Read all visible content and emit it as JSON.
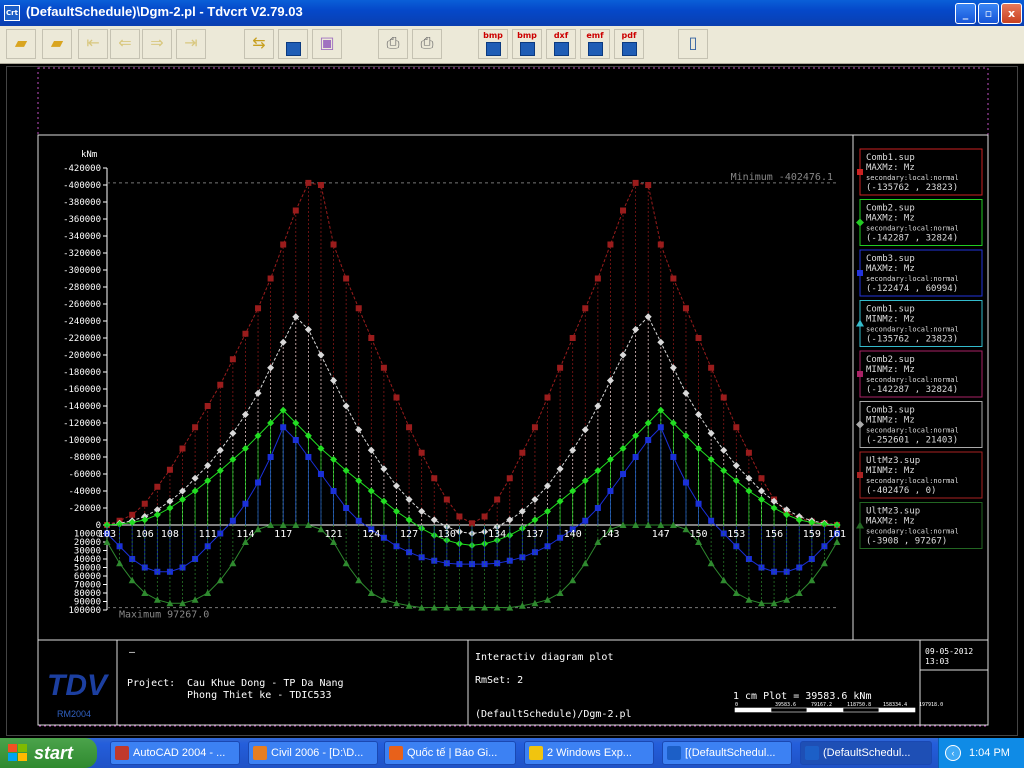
{
  "window": {
    "title": "(DefaultSchedule)\\Dgm-2.pl - Tdvcrt V2.79.03",
    "icon_text": "Crt",
    "buttons": [
      "_",
      "▫",
      "x"
    ]
  },
  "toolbar": {
    "export_labels": [
      "bmp",
      "bmp",
      "dxf",
      "emf",
      "pdf"
    ]
  },
  "chart_data": {
    "type": "line",
    "unit": "kNm",
    "x": [
      103,
      104,
      105,
      106,
      107,
      108,
      109,
      110,
      111,
      112,
      113,
      114,
      115,
      116,
      117,
      118,
      119,
      120,
      121,
      122,
      123,
      124,
      125,
      126,
      127,
      128,
      129,
      130,
      131,
      132,
      133,
      134,
      135,
      136,
      137,
      138,
      139,
      140,
      141,
      142,
      143,
      144,
      145,
      146,
      147,
      148,
      149,
      150,
      151,
      152,
      153,
      154,
      155,
      156,
      157,
      158,
      159,
      160,
      161
    ],
    "x_tick_labels": [
      {
        "label": "103",
        "x": 103
      },
      {
        "label": "106",
        "x": 106
      },
      {
        "label": "108",
        "x": 108
      },
      {
        "label": "111",
        "x": 111
      },
      {
        "label": "114",
        "x": 114
      },
      {
        "label": "117",
        "x": 117
      },
      {
        "label": "121",
        "x": 121
      },
      {
        "label": "124",
        "x": 124
      },
      {
        "label": "127",
        "x": 127
      },
      {
        "label": "130",
        "x": 130
      },
      {
        "label": "134",
        "x": 134
      },
      {
        "label": "137",
        "x": 137
      },
      {
        "label": "140",
        "x": 140
      },
      {
        "label": "143",
        "x": 143
      },
      {
        "label": "147",
        "x": 147
      },
      {
        "label": "150",
        "x": 150
      },
      {
        "label": "153",
        "x": 153
      },
      {
        "label": "156",
        "x": 156
      },
      {
        "label": "159",
        "x": 159
      },
      {
        "label": "161",
        "x": 161
      }
    ],
    "y_ticks_neg": [
      "-420000",
      "-400000",
      "-380000",
      "-360000",
      "-340000",
      "-320000",
      "-300000",
      "-280000",
      "-260000",
      "-240000",
      "-220000",
      "-200000",
      "-180000",
      "-160000",
      "-140000",
      "-120000",
      "-100000",
      "-80000",
      "-60000",
      "-40000",
      "-20000",
      "0"
    ],
    "y_ticks_pos": [
      "10000",
      "20000",
      "30000",
      "40000",
      "50000",
      "60000",
      "70000",
      "80000",
      "90000",
      "100000"
    ],
    "ylim": [
      -420000,
      100000
    ],
    "min_annotation": "Minimum  -402476.1",
    "max_annotation": "Maximum  97267.0",
    "series": [
      {
        "name": "UltMz3.sup MINMz",
        "color": "#9a1c1c",
        "marker": "square",
        "values": [
          0,
          -5000,
          -12000,
          -25000,
          -45000,
          -65000,
          -90000,
          -115000,
          -140000,
          -165000,
          -195000,
          -225000,
          -255000,
          -290000,
          -330000,
          -370000,
          -402476,
          -400000,
          -330000,
          -290000,
          -255000,
          -220000,
          -185000,
          -150000,
          -115000,
          -85000,
          -55000,
          -30000,
          -10000,
          -2000,
          -10000,
          -30000,
          -55000,
          -85000,
          -115000,
          -150000,
          -185000,
          -220000,
          -255000,
          -290000,
          -330000,
          -370000,
          -402476,
          -400000,
          -330000,
          -290000,
          -255000,
          -220000,
          -185000,
          -150000,
          -115000,
          -85000,
          -55000,
          -30000,
          -15000,
          -8000,
          -4000,
          -2000,
          0
        ]
      },
      {
        "name": "Comb3.sup MINMz",
        "color": "#d9d9d9",
        "marker": "diamond",
        "values": [
          0,
          -2000,
          -5000,
          -10000,
          -18000,
          -28000,
          -40000,
          -55000,
          -70000,
          -88000,
          -108000,
          -130000,
          -155000,
          -185000,
          -215000,
          -245000,
          -230000,
          -200000,
          -170000,
          -140000,
          -112000,
          -88000,
          -66000,
          -46000,
          -30000,
          -16000,
          -6000,
          2000,
          8000,
          10000,
          8000,
          2000,
          -6000,
          -16000,
          -30000,
          -46000,
          -66000,
          -88000,
          -112000,
          -140000,
          -170000,
          -200000,
          -230000,
          -245000,
          -215000,
          -185000,
          -155000,
          -130000,
          -108000,
          -88000,
          -70000,
          -55000,
          -40000,
          -28000,
          -18000,
          -10000,
          -5000,
          -2000,
          0
        ]
      },
      {
        "name": "Comb2.sup MAXMz",
        "color": "#22dd22",
        "marker": "diamond",
        "values": [
          0,
          -1000,
          -3000,
          -6000,
          -12000,
          -20000,
          -30000,
          -40000,
          -52000,
          -64000,
          -77000,
          -90000,
          -105000,
          -120000,
          -135000,
          -120000,
          -105000,
          -90000,
          -77000,
          -64000,
          -52000,
          -40000,
          -28000,
          -16000,
          -6000,
          4000,
          12000,
          18000,
          22000,
          24000,
          22000,
          18000,
          12000,
          4000,
          -6000,
          -16000,
          -28000,
          -40000,
          -52000,
          -64000,
          -77000,
          -90000,
          -105000,
          -120000,
          -135000,
          -120000,
          -105000,
          -90000,
          -77000,
          -64000,
          -52000,
          -40000,
          -30000,
          -20000,
          -12000,
          -6000,
          -3000,
          -1000,
          0
        ]
      },
      {
        "name": "Comb3.sup MAXMz",
        "color": "#1a30d8",
        "marker": "square",
        "values": [
          10000,
          25000,
          40000,
          50000,
          55000,
          55000,
          50000,
          40000,
          25000,
          10000,
          -5000,
          -25000,
          -50000,
          -80000,
          -115000,
          -100000,
          -80000,
          -60000,
          -40000,
          -20000,
          -5000,
          5000,
          15000,
          25000,
          32000,
          38000,
          42000,
          45000,
          46000,
          46000,
          46000,
          45000,
          42000,
          38000,
          32000,
          25000,
          15000,
          5000,
          -5000,
          -20000,
          -40000,
          -60000,
          -80000,
          -100000,
          -115000,
          -80000,
          -50000,
          -25000,
          -5000,
          10000,
          25000,
          40000,
          50000,
          55000,
          55000,
          50000,
          40000,
          25000,
          10000
        ]
      },
      {
        "name": "UltMz3.sup MAXMz",
        "color": "#2f8a2f",
        "marker": "triangle",
        "values": [
          20000,
          45000,
          65000,
          80000,
          88000,
          92000,
          92000,
          88000,
          80000,
          65000,
          45000,
          20000,
          5000,
          0,
          0,
          0,
          0,
          5000,
          20000,
          45000,
          65000,
          80000,
          88000,
          92000,
          95000,
          97267,
          97000,
          97000,
          97000,
          97000,
          97000,
          97000,
          97267,
          95000,
          92000,
          88000,
          80000,
          65000,
          45000,
          20000,
          5000,
          0,
          0,
          0,
          0,
          0,
          5000,
          20000,
          45000,
          65000,
          80000,
          88000,
          92000,
          92000,
          88000,
          80000,
          65000,
          45000,
          20000
        ]
      }
    ]
  },
  "legend": [
    {
      "name": "Comb1.sup",
      "type": "MAXMz: Mz",
      "desc": "secondary:local:normal",
      "range": "(-135762 ,   23823)",
      "color": "#cc2222",
      "marker": "square"
    },
    {
      "name": "Comb2.sup",
      "type": "MAXMz: Mz",
      "desc": "secondary:local:normal",
      "range": "(-142287 ,   32824)",
      "color": "#22cc22",
      "marker": "diamond"
    },
    {
      "name": "Comb3.sup",
      "type": "MAXMz: Mz",
      "desc": "secondary:local:normal",
      "range": "(-122474 ,   60994)",
      "color": "#2233dd",
      "marker": "square"
    },
    {
      "name": "Comb1.sup",
      "type": "MINMz: Mz",
      "desc": "secondary:local:normal",
      "range": "(-135762 ,   23823)",
      "color": "#33bbcc",
      "marker": "triangle"
    },
    {
      "name": "Comb2.sup",
      "type": "MINMz: Mz",
      "desc": "secondary:local:normal",
      "range": "(-142287 ,   32824)",
      "color": "#aa2266",
      "marker": "square"
    },
    {
      "name": "Comb3.sup",
      "type": "MINMz: Mz",
      "desc": "secondary:local:normal",
      "range": "(-252601 ,   21403)",
      "color": "#aaaaaa",
      "marker": "diamond"
    },
    {
      "name": "UltMz3.sup",
      "type": "MINMz: Mz",
      "desc": "secondary:local:normal",
      "range": "(-402476 ,      0)",
      "color": "#aa2222",
      "marker": "square"
    },
    {
      "name": "UltMz3.sup",
      "type": "MAXMz: Mz",
      "desc": "secondary:local:normal",
      "range": "(-3908 ,   97267)",
      "color": "#226622",
      "marker": "triangle"
    }
  ],
  "footer": {
    "logo": "TDV",
    "logo_sub": "RM2004",
    "project_label": "Project:",
    "project_name": "Cau Khue Dong - TP Da Nang",
    "project_office": "Phong Thiet ke - TDIC533",
    "dash": "—",
    "plot_title": "Interactiv diagram plot",
    "rmset": "RmSet:  2",
    "file": "(DefaultSchedule)/Dgm-2.pl",
    "scale": "1 cm Plot =   39583.6 kNm",
    "scale_ticks": [
      "0",
      "39583.6",
      "79167.2",
      "118750.8",
      "158334.4",
      "197918.0"
    ],
    "date": "09-05-2012",
    "time": "13:03"
  },
  "taskbar": {
    "start": "start",
    "tasks": [
      {
        "label": "AutoCAD 2004 - ...",
        "color": "#c0392b"
      },
      {
        "label": "Civil 2006 - [D:\\D...",
        "color": "#e67e22"
      },
      {
        "label": "Quốc tế | Báo Gi...",
        "color": "#e8611a"
      },
      {
        "label": "2 Windows Exp...",
        "color": "#f1c40f"
      },
      {
        "label": "[(DefaultSchedul...",
        "color": "#1c5fc7"
      },
      {
        "label": "(DefaultSchedul...",
        "color": "#1c5fc7"
      }
    ],
    "clock": "1:04 PM"
  }
}
